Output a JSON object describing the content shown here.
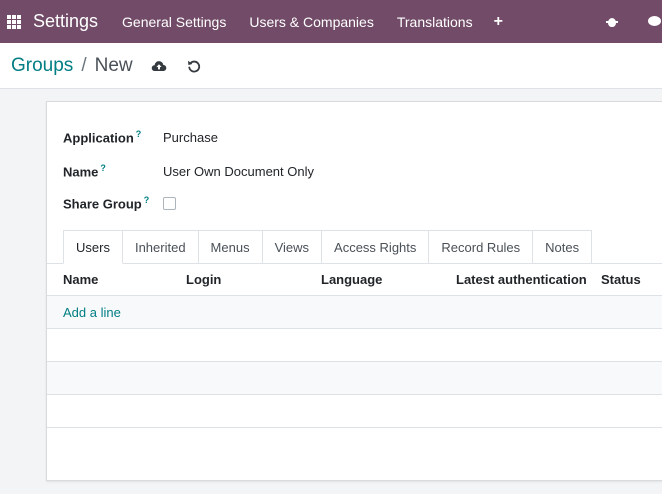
{
  "navbar": {
    "app_title": "Settings",
    "menu": [
      "General Settings",
      "Users & Companies",
      "Translations"
    ],
    "plus": "+",
    "icons": {
      "apps": "apps-grid-icon",
      "debug": "bug-icon",
      "chat": "chat-icon"
    }
  },
  "breadcrumb": {
    "parent": "Groups",
    "separator": "/",
    "current": "New"
  },
  "form": {
    "application": {
      "label": "Application",
      "help": "?",
      "value": "Purchase"
    },
    "name": {
      "label": "Name",
      "help": "?",
      "value": "User Own Document Only"
    },
    "share_group": {
      "label": "Share Group",
      "help": "?",
      "checked": false
    }
  },
  "tabs": [
    "Users",
    "Inherited",
    "Menus",
    "Views",
    "Access Rights",
    "Record Rules",
    "Notes"
  ],
  "users_table": {
    "columns": [
      "Name",
      "Login",
      "Language",
      "Latest authentication",
      "Status"
    ],
    "add_line": "Add a line"
  },
  "colors": {
    "brand": "#714b67",
    "link": "#017e84"
  }
}
